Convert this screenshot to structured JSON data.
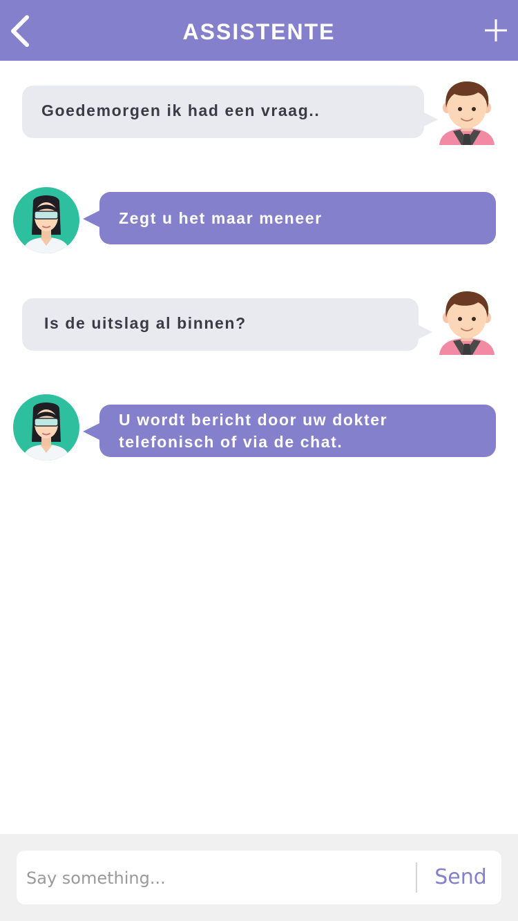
{
  "header": {
    "title": "ASSISTENTE",
    "back_icon": "chevron-left-icon",
    "add_icon": "plus-icon",
    "color": "#8480cc"
  },
  "messages": [
    {
      "sender": "user",
      "avatar": "male-avatar-icon",
      "text": "Goedemorgen ik had een vraag.."
    },
    {
      "sender": "assistant",
      "avatar": "female-doctor-avatar-icon",
      "text": "Zegt u het maar meneer"
    },
    {
      "sender": "user",
      "avatar": "male-avatar-icon",
      "text": "Is de uitslag al binnen?"
    },
    {
      "sender": "assistant",
      "avatar": "female-doctor-avatar-icon",
      "text": "U wordt bericht door uw dokter telefonisch of via de chat."
    }
  ],
  "composer": {
    "placeholder": "Say something...",
    "value": "",
    "send_label": "Send"
  },
  "colors": {
    "accent": "#8480cc",
    "user_bubble": "#e9e9f0",
    "user_text": "#3b3b48",
    "bot_text": "#ffffff",
    "avatar_bg_assistant": "#2ebf9f"
  }
}
